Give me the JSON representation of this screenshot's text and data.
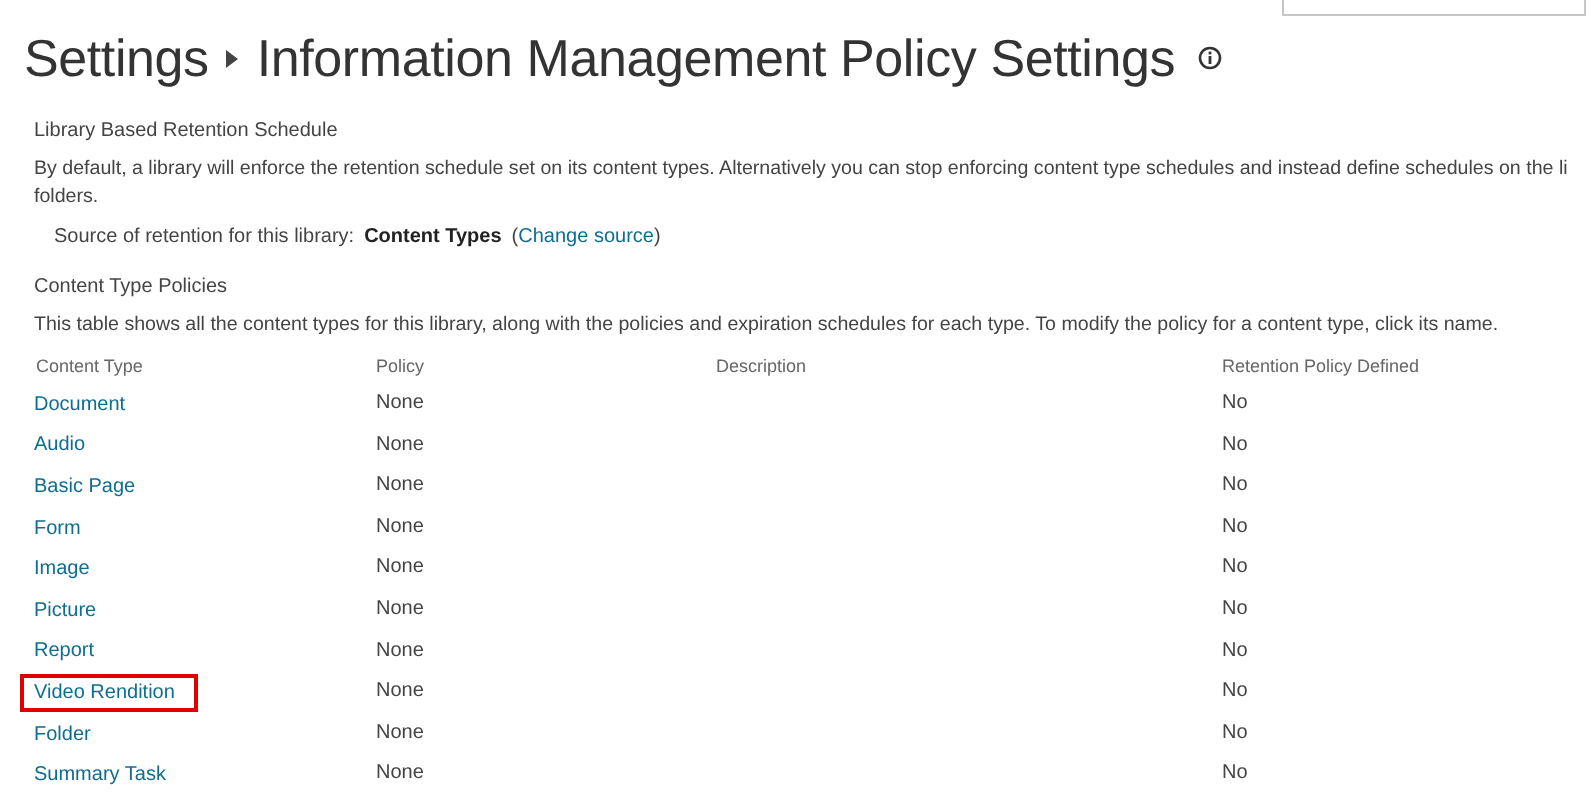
{
  "header": {
    "breadcrumb": [
      "Settings",
      "Information Management Policy Settings"
    ]
  },
  "retention": {
    "heading": "Library Based Retention Schedule",
    "description_lines": [
      "By default, a library will enforce the retention schedule set on its content types. Alternatively you can stop enforcing content type schedules and instead define schedules on the li",
      "folders."
    ],
    "source_label": "Source of retention for this library:",
    "source_value": "Content Types",
    "change_link": {
      "open": "(",
      "label": "Change source",
      "close": ")"
    }
  },
  "policies": {
    "heading": "Content Type Policies",
    "description": "This table shows all the content types for this library, along with the policies and expiration schedules for each type. To modify the policy for a content type, click its name.",
    "table": {
      "columns": [
        "Content Type",
        "Policy",
        "Description",
        "Retention Policy Defined"
      ],
      "rows": [
        {
          "name": "Document",
          "policy": "None",
          "retention": "No",
          "highlighted": false
        },
        {
          "name": "Audio",
          "policy": "None",
          "retention": "No",
          "highlighted": false
        },
        {
          "name": "Basic Page",
          "policy": "None",
          "retention": "No",
          "highlighted": false
        },
        {
          "name": "Form",
          "policy": "None",
          "retention": "No",
          "highlighted": false
        },
        {
          "name": "Image",
          "policy": "None",
          "retention": "No",
          "highlighted": false
        },
        {
          "name": "Picture",
          "policy": "None",
          "retention": "No",
          "highlighted": false
        },
        {
          "name": "Report",
          "policy": "None",
          "retention": "No",
          "highlighted": false
        },
        {
          "name": "Video Rendition",
          "policy": "None",
          "retention": "No",
          "highlighted": true
        },
        {
          "name": "Folder",
          "policy": "None",
          "retention": "No",
          "highlighted": false
        },
        {
          "name": "Summary Task",
          "policy": "None",
          "retention": "No",
          "highlighted": false
        }
      ]
    }
  }
}
